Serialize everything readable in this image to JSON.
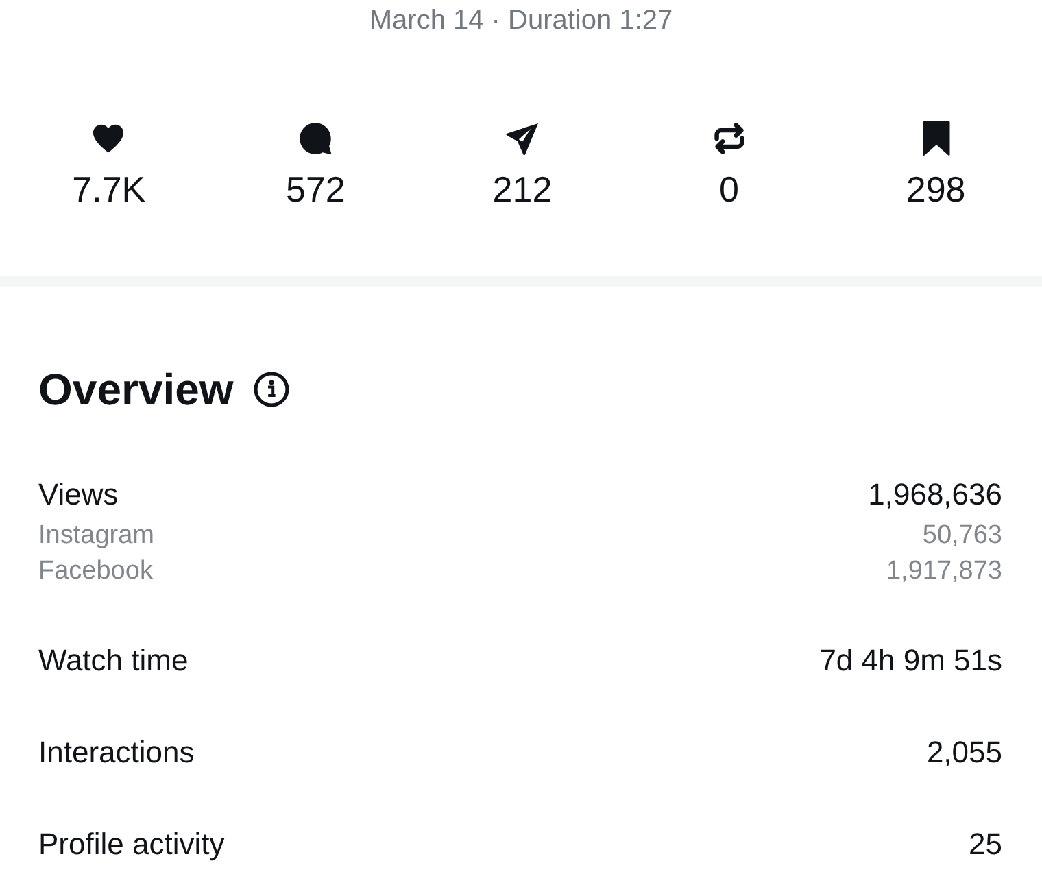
{
  "subtitle": "March 14 · Duration 1:27",
  "stats": [
    {
      "kind": "likes",
      "value": "7.7K"
    },
    {
      "kind": "comments",
      "value": "572"
    },
    {
      "kind": "shares",
      "value": "212"
    },
    {
      "kind": "reposts",
      "value": "0"
    },
    {
      "kind": "saves",
      "value": "298"
    }
  ],
  "overview": {
    "title": "Overview",
    "metrics": [
      {
        "label": "Views",
        "value": "1,968,636",
        "breakdown": [
          {
            "label": "Instagram",
            "value": "50,763"
          },
          {
            "label": "Facebook",
            "value": "1,917,873"
          }
        ]
      },
      {
        "label": "Watch time",
        "value": "7d 4h 9m 51s"
      },
      {
        "label": "Interactions",
        "value": "2,055"
      },
      {
        "label": "Profile activity",
        "value": "25"
      }
    ]
  }
}
